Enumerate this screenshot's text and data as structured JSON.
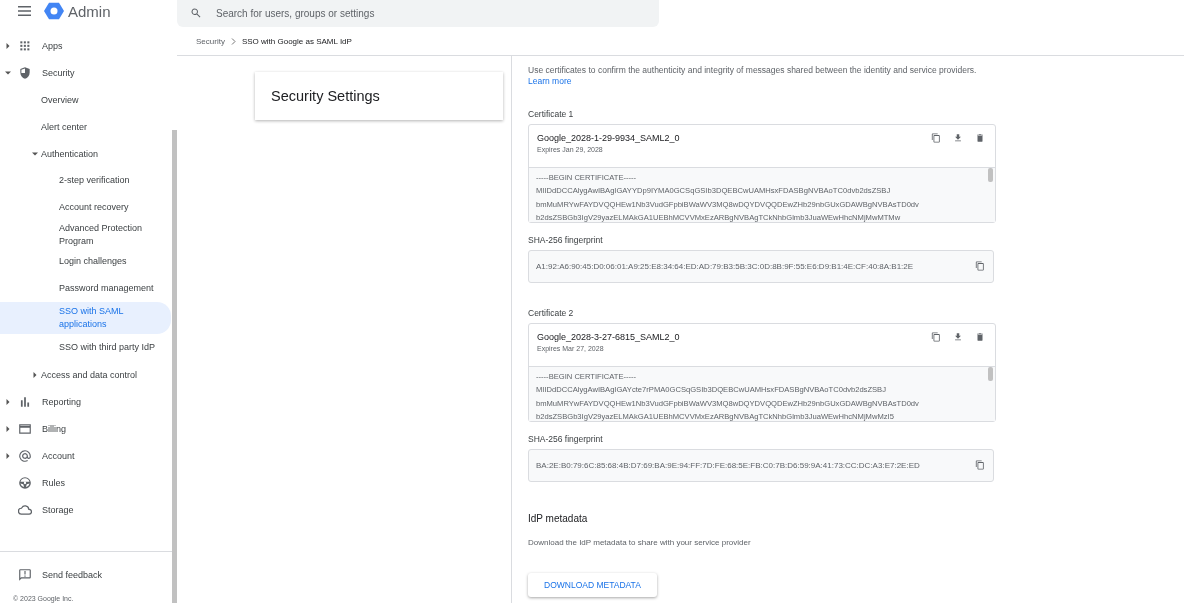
{
  "header": {
    "app_name": "Admin",
    "search": {
      "placeholder": "Search for users, groups or settings"
    }
  },
  "breadcrumb": [
    {
      "label": "Security"
    },
    {
      "label": "SSO with Google as SAML IdP"
    }
  ],
  "sidebar": {
    "items": [
      {
        "label": "Apps",
        "expanded": false,
        "selected": false
      },
      {
        "label": "Security",
        "expanded": true,
        "selected": false,
        "children": [
          {
            "label": "Overview",
            "selected": false
          },
          {
            "label": "Alert center",
            "selected": false
          },
          {
            "label": "Authentication",
            "expanded": true,
            "selected": false,
            "children": [
              {
                "label": "2-step verification",
                "selected": false
              },
              {
                "label": "Account recovery",
                "selected": false
              },
              {
                "label": "Advanced Protection Program",
                "selected": false
              },
              {
                "label": "Login challenges",
                "selected": false
              },
              {
                "label": "Password management",
                "selected": false
              },
              {
                "label": "SSO with SAML applications",
                "selected": true
              },
              {
                "label": "SSO with third party IdP",
                "selected": false
              }
            ]
          },
          {
            "label": "Access and data control",
            "expanded": false,
            "selected": false
          }
        ]
      },
      {
        "label": "Reporting",
        "expanded": false,
        "selected": false
      },
      {
        "label": "Billing",
        "expanded": false,
        "selected": false
      },
      {
        "label": "Account",
        "expanded": false,
        "selected": false
      },
      {
        "label": "Rules",
        "selected": false
      },
      {
        "label": "Storage",
        "selected": false
      }
    ],
    "feedback": "Send feedback",
    "copyright": "© 2023 Google Inc."
  },
  "settings_card": {
    "title": "Security Settings"
  },
  "intro": {
    "text": "Use certificates to confirm the authenticity and integrity of messages shared between the identity and service providers.",
    "link": "Learn more"
  },
  "certificates": [
    {
      "label": "Certificate 1",
      "name": "Google_2028-1-29-9934_SAML2_0",
      "expires": "Expires Jan 29, 2028",
      "lines": [
        "-----BEGIN CERTIFICATE-----",
        "MIIDdDCCAlygAwIBAgIGAYYDp9IYMA0GCSqGSIb3DQEBCwUAMHsxFDASBgNVBAoTC0dvb2dsZSBJ",
        "bmMuMRYwFAYDVQQHEw1Nb3VudGFpbiBWaWV3MQ8wDQYDVQQDEwZHb29nbGUxGDAWBgNVBAsTD0dv",
        "b2dsZSBGb3IgV29yazELMAkGA1UEBhMCVVMxEzARBgNVBAgTCkNhbGlmb3JuaWEwHhcNMjMwMTMw"
      ],
      "fingerprint_label": "SHA-256 fingerprint",
      "fingerprint": "A1:92:A6:90:45:D0:06:01:A9:25:E8:34:64:ED:AD:79:B3:5B:3C:0D:8B:9F:55:E6:D9:B1:4E:CF:40:8A:B1:2E"
    },
    {
      "label": "Certificate 2",
      "name": "Google_2028-3-27-6815_SAML2_0",
      "expires": "Expires Mar 27, 2028",
      "lines": [
        "-----BEGIN CERTIFICATE-----",
        "MIIDdDCCAlygAwIBAgIGAYcte7rPMA0GCSqGSIb3DQEBCwUAMHsxFDASBgNVBAoTC0dvb2dsZSBJ",
        "bmMuMRYwFAYDVQQHEw1Nb3VudGFpbiBWaWV3MQ8wDQYDVQQDEwZHb29nbGUxGDAWBgNVBAsTD0dv",
        "b2dsZSBGb3IgV29yazELMAkGA1UEBhMCVVMxEzARBgNVBAgTCkNhbGlmb3JuaWEwHhcNMjMwMzI5"
      ],
      "fingerprint_label": "SHA-256 fingerprint",
      "fingerprint": "BA:2E:B0:79:6C:85:68:4B:D7:69:BA:9E:94:FF:7D:FE:68:5E:FB:C0:7B:D6:59:9A:41:73:CC:DC:A3:E7:2E:ED"
    }
  ],
  "metadata": {
    "title": "IdP metadata",
    "description": "Download the IdP metadata to share with your service provider",
    "button": "DOWNLOAD METADATA"
  }
}
